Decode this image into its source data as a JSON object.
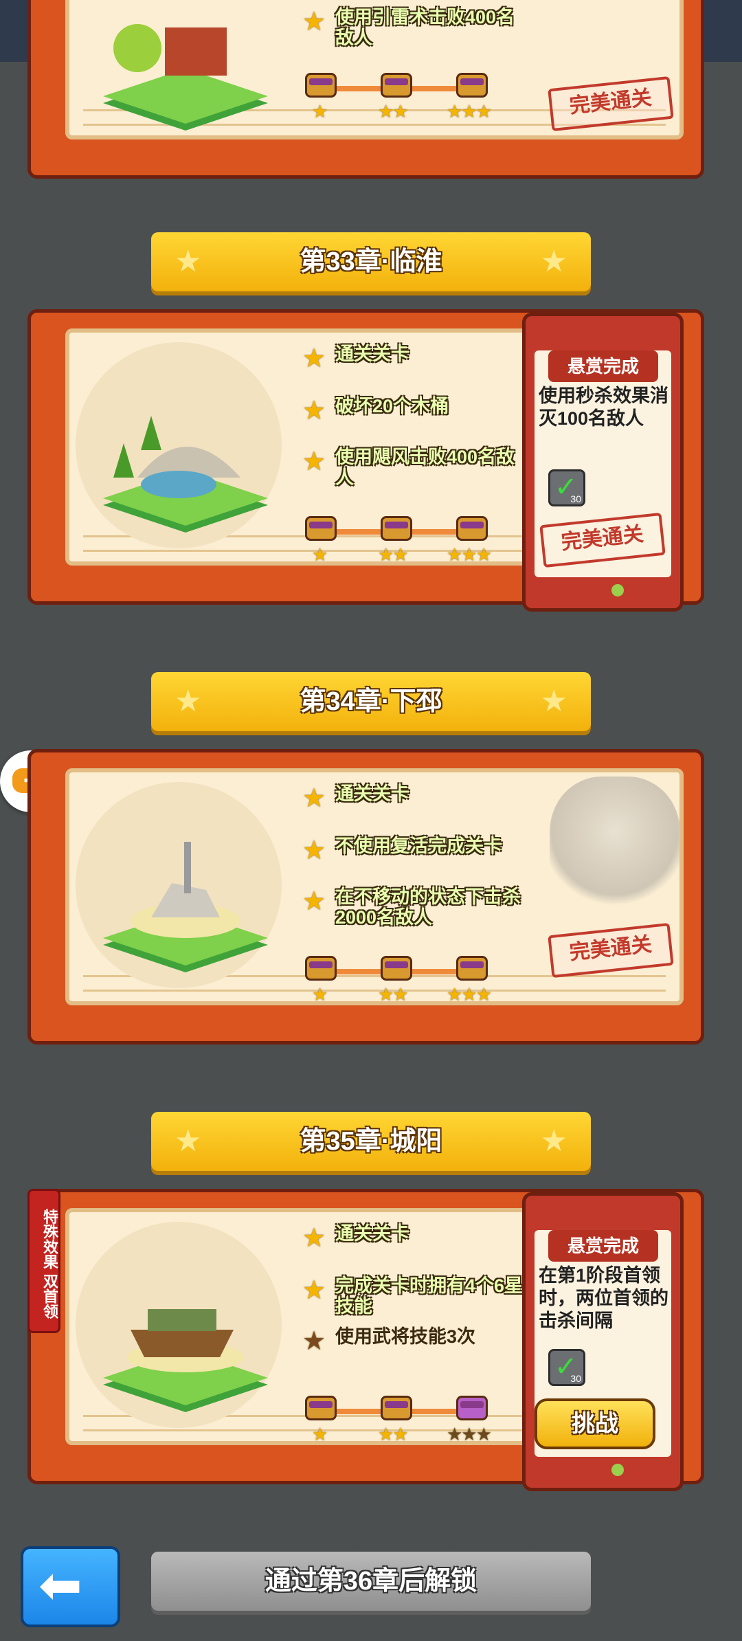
{
  "chapters": [
    {
      "objectives": [
        "使用引雷术击败400名敌人"
      ],
      "stamp": "完美通关"
    },
    {
      "title": "第33章·临淮",
      "objectives": [
        "通关关卡",
        "破坏20个木桶",
        "使用飓风击败400名敌人"
      ],
      "bounty": {
        "title": "悬赏完成",
        "text": "使用秒杀效果消灭100名敌人",
        "count": "30",
        "stamp": "完美通关"
      }
    },
    {
      "title": "第34章·下邳",
      "objectives": [
        "通关关卡",
        "不使用复活完成关卡",
        "在不移动的状态下击杀2000名敌人"
      ],
      "stamp": "完美通关"
    },
    {
      "title": "第35章·城阳",
      "objectives": [
        "通关关卡",
        "完成关卡时拥有4个6星技能",
        "使用武将技能3次"
      ],
      "special": "特殊效果 双首领",
      "bounty": {
        "title": "悬赏完成",
        "text": "在第1阶段首领时，两位首领的击杀间隔",
        "count": "30",
        "button": "挑战"
      }
    }
  ],
  "locked": {
    "title": "通过第36章后解锁"
  },
  "icons": {
    "star": "star-icon",
    "chest": "treasure-chest-icon",
    "back": "back-arrow-icon",
    "gamepad": "gamepad-icon",
    "check": "check-icon"
  },
  "colors": {
    "ribbon": "#f7c21a",
    "card": "#d9541e",
    "background": "#4b4f4f",
    "objective_text": "#e9ffb0"
  }
}
